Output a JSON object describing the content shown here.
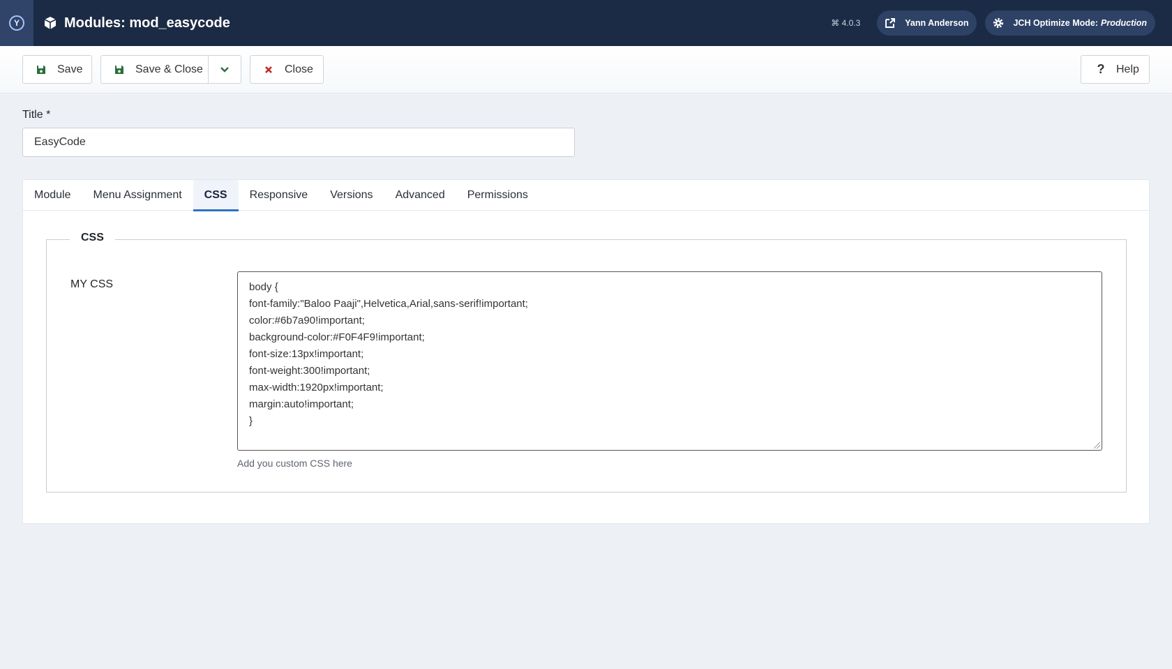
{
  "header": {
    "title": "Modules: mod_easycode",
    "version": "4.0.3",
    "user_name": "Yann Anderson",
    "jch_label": "JCH Optimize Mode:",
    "jch_mode": "Production"
  },
  "toolbar": {
    "save_label": "Save",
    "save_close_label": "Save & Close",
    "close_label": "Close",
    "help_label": "Help"
  },
  "form": {
    "title_label": "Title *",
    "title_value": "EasyCode"
  },
  "tabs": [
    {
      "label": "Module"
    },
    {
      "label": "Menu Assignment"
    },
    {
      "label": "CSS",
      "active": true
    },
    {
      "label": "Responsive"
    },
    {
      "label": "Versions"
    },
    {
      "label": "Advanced"
    },
    {
      "label": "Permissions"
    }
  ],
  "css_panel": {
    "legend": "CSS",
    "field_label": "MY CSS",
    "code_lines": [
      "body {",
      "font-family:\"Baloo Paaji\",Helvetica,Arial,sans-serif!important;",
      "color:#6b7a90!important;",
      "background-color:#F0F4F9!important;",
      "font-size:13px!important;",
      "font-weight:300!important;",
      "max-width:1920px!important;",
      "margin:auto!important;",
      "}"
    ],
    "help_text": "Add you custom CSS here"
  },
  "colors": {
    "header_bg": "#1c2b45",
    "accent": "#3071c4",
    "save_icon": "#2c6e3c",
    "close_icon": "#c52827"
  }
}
